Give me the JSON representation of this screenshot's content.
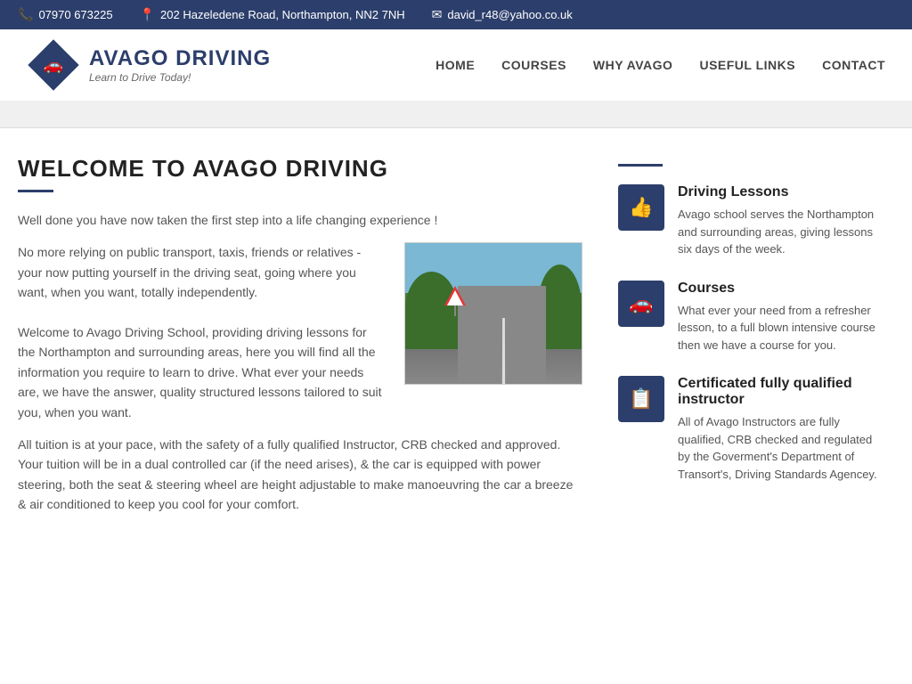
{
  "topbar": {
    "phone": "07970 673225",
    "address": "202 Hazeledene Road, Northampton, NN2 7NH",
    "email": "david_r48@yahoo.co.uk"
  },
  "header": {
    "logo_title": "AVAGO DRIVING",
    "logo_subtitle": "Learn to Drive Today!",
    "nav": [
      {
        "label": "HOME",
        "href": "#"
      },
      {
        "label": "COURSES",
        "href": "#"
      },
      {
        "label": "WHY AVAGO",
        "href": "#"
      },
      {
        "label": "USEFUL LINKS",
        "href": "#"
      },
      {
        "label": "CONTACT",
        "href": "#"
      }
    ]
  },
  "main": {
    "page_title": "WELCOME TO AVAGO DRIVING",
    "intro": "Well done you have now taken the first step into a life changing experience !",
    "para1": "No more relying on public transport, taxis, friends or relatives - your now putting yourself in the driving seat, going where you want, when you want, totally independently.",
    "para2": "Welcome to Avago Driving School, providing driving lessons for the Northampton and surrounding areas, here you will find all the information you require to learn to drive. What ever your needs are, we have the answer, quality structured lessons tailored to suit you, when you want.",
    "para3": "All tuition is at your pace, with the safety of a fully qualified Instructor, CRB checked and approved. Your tuition will be in a dual controlled car (if the need arises), & the car is equipped with power steering, both the seat & steering wheel are height adjustable to make manoeuvring the car a breeze & air conditioned to keep you cool for your comfort."
  },
  "sidebar": {
    "features": [
      {
        "icon": "👍",
        "title": "Driving Lessons",
        "description": "Avago school serves the Northampton and surrounding areas, giving lessons six days of the week."
      },
      {
        "icon": "🚗",
        "title": "Courses",
        "description": "What ever your need from a refresher lesson, to a full blown intensive course then we have a course for you."
      },
      {
        "icon": "📋",
        "title": "Certificated fully qualified instructor",
        "description": "All of Avago Instructors are fully qualified, CRB checked and regulated by the Goverment's Department of Transort's, Driving Standards Agencey."
      }
    ]
  }
}
